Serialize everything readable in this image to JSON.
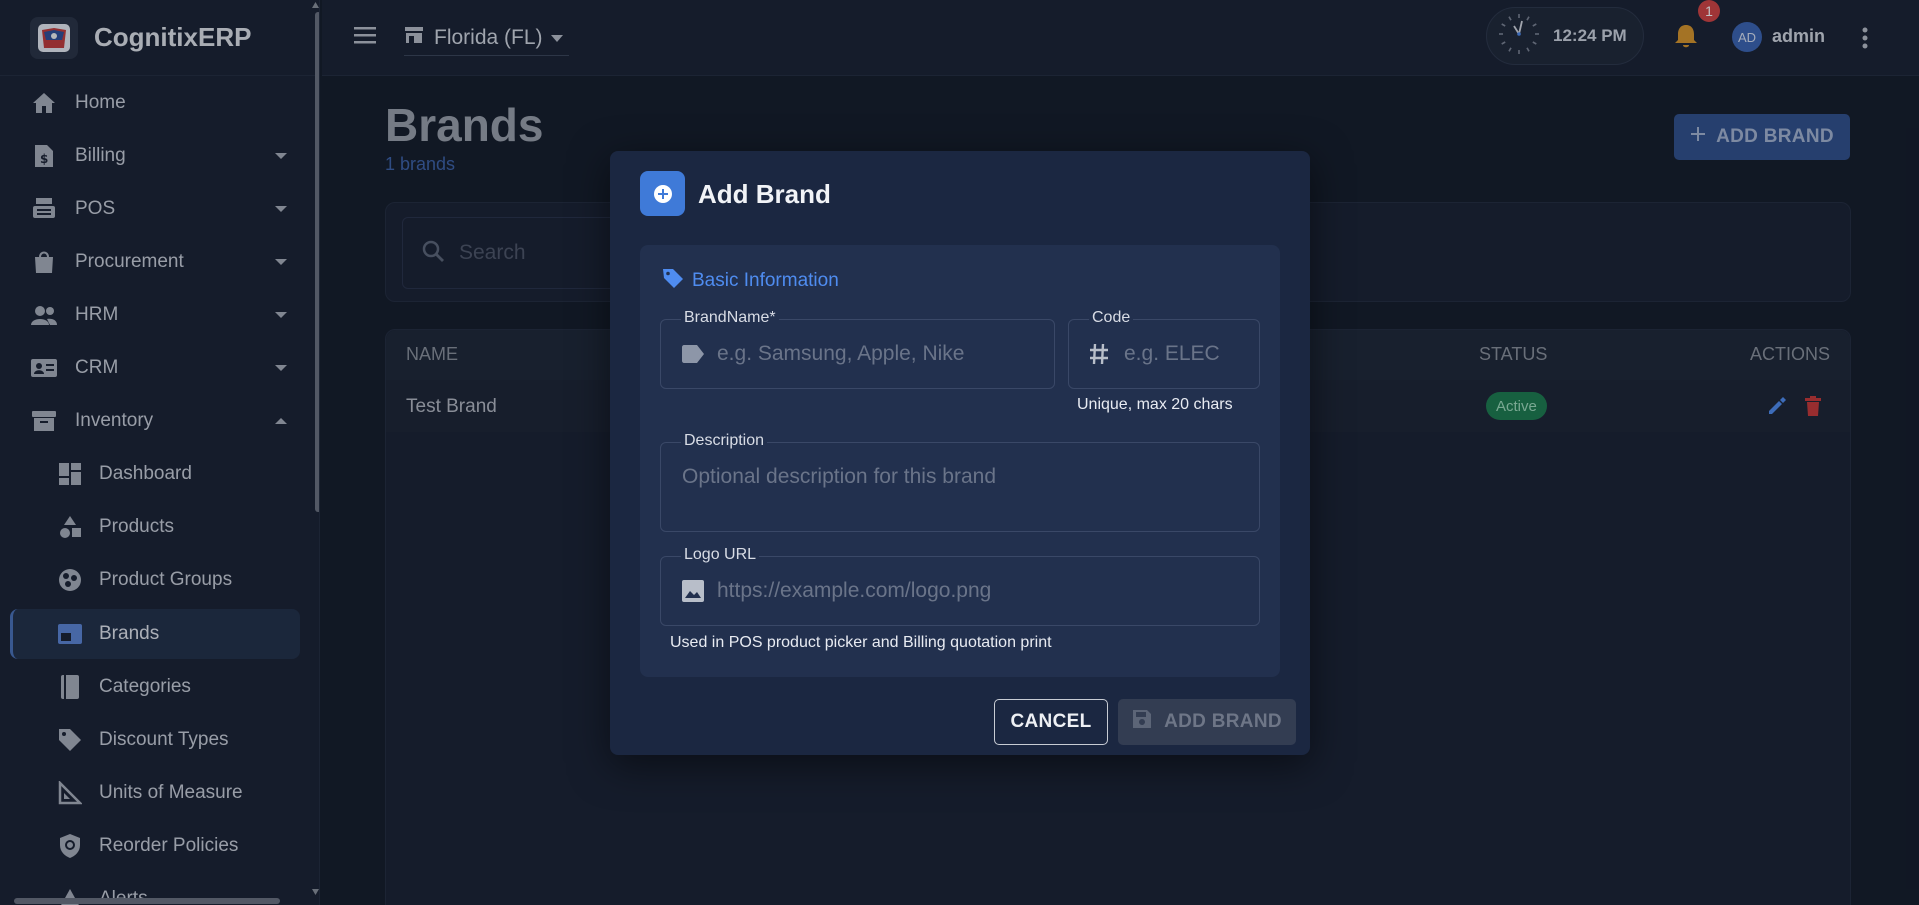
{
  "app": {
    "name": "CognitixERP"
  },
  "sidebar": {
    "items": [
      {
        "label": "Home",
        "icon": "home-icon"
      },
      {
        "label": "Billing",
        "icon": "billing-icon"
      },
      {
        "label": "POS",
        "icon": "pos-icon"
      },
      {
        "label": "Procurement",
        "icon": "procurement-icon"
      },
      {
        "label": "HRM",
        "icon": "hrm-icon"
      },
      {
        "label": "CRM",
        "icon": "crm-icon"
      },
      {
        "label": "Inventory",
        "icon": "inventory-icon"
      }
    ],
    "sub_items": [
      {
        "label": "Dashboard",
        "icon": "dashboard-icon"
      },
      {
        "label": "Products",
        "icon": "products-icon"
      },
      {
        "label": "Product Groups",
        "icon": "product-groups-icon"
      },
      {
        "label": "Brands",
        "icon": "brands-icon",
        "active": true
      },
      {
        "label": "Categories",
        "icon": "categories-icon"
      },
      {
        "label": "Discount Types",
        "icon": "tag-icon"
      },
      {
        "label": "Units of Measure",
        "icon": "ruler-icon"
      },
      {
        "label": "Reorder Policies",
        "icon": "policy-icon"
      },
      {
        "label": "Alerts",
        "icon": "alert-icon"
      }
    ]
  },
  "topbar": {
    "store": "Florida (FL)",
    "time": "12:24 PM",
    "notifications": "1",
    "avatar_initials": "AD",
    "user": "admin"
  },
  "page": {
    "title": "Brands",
    "count": "1 brands",
    "add_button": "ADD BRAND",
    "search_placeholder": "Search"
  },
  "table": {
    "headers": {
      "name": "NAME",
      "status": "STATUS",
      "actions": "ACTIONS"
    },
    "rows": [
      {
        "name": "Test Brand",
        "status": "Active"
      }
    ]
  },
  "modal": {
    "title": "Add Brand",
    "section_title": "Basic Information",
    "brand_name": {
      "label": "BrandName*",
      "placeholder": "e.g. Samsung, Apple, Nike"
    },
    "code": {
      "label": "Code",
      "placeholder": "e.g. ELEC",
      "helper": "Unique, max 20 chars"
    },
    "description": {
      "label": "Description",
      "placeholder": "Optional description for this brand"
    },
    "logo_url": {
      "label": "Logo URL",
      "placeholder": "https://example.com/logo.png",
      "helper": "Used in POS product picker and Billing quotation print"
    },
    "cancel": "CANCEL",
    "submit": "ADD BRAND"
  },
  "colors": {
    "accent": "#3f7ad8",
    "status_active": "#1d7d4f",
    "danger": "#c93838"
  }
}
